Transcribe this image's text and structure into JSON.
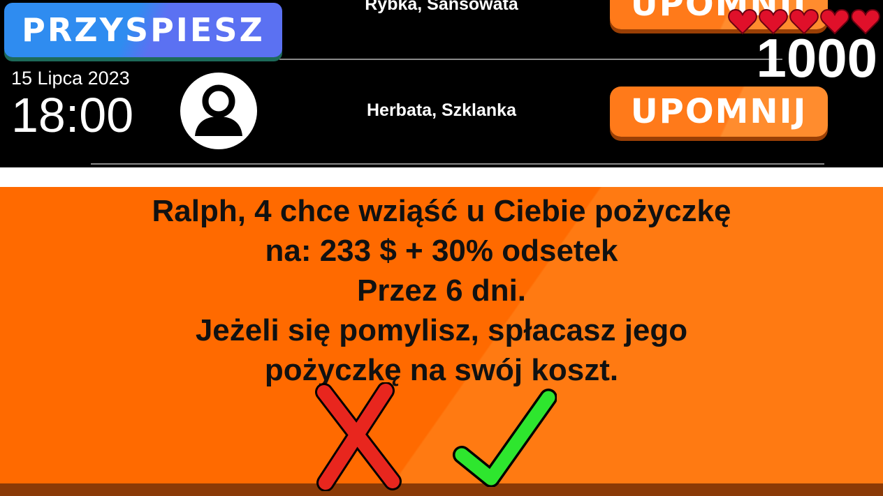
{
  "header": {
    "speed_button_label": "PRZYSPIESZ",
    "row1_items": "Rybka, Sansowata",
    "row1_button": "UPOMNIJ",
    "row2_items": "Herbata, Szklanka",
    "row2_button": "UPOMNIJ",
    "date": "15 Lipca 2023",
    "time": "18:00",
    "money": "1000",
    "lives": 5
  },
  "dialog": {
    "line1": "Ralph, 4 chce wziąść u Ciebie pożyczkę",
    "line2": "na: 233 $ + 30% odsetek",
    "line3": "Przez 6 dni.",
    "line4": "Jeżeli się pomylisz, spłacasz jego",
    "line5": "pożyczkę na swój koszt."
  },
  "colors": {
    "speed_button": "#2f8cf0",
    "remind_button": "#ff7a1a",
    "dialog_bg": "#ff6a00",
    "reject": "#e8261e",
    "accept": "#2ee62e",
    "heart": "#e0102a"
  },
  "icons": {
    "reject": "x-mark-icon",
    "accept": "check-mark-icon",
    "avatar": "user-avatar-icon",
    "life": "heart-icon"
  }
}
